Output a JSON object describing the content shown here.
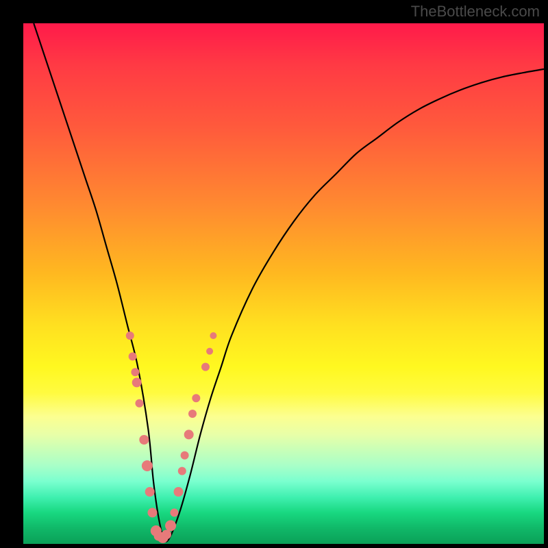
{
  "watermark": "TheBottleneck.com",
  "chart_data": {
    "type": "line",
    "title": "",
    "xlabel": "",
    "ylabel": "",
    "xlim": [
      0,
      100
    ],
    "ylim": [
      0,
      100
    ],
    "series": [
      {
        "name": "bottleneck-curve",
        "x": [
          2,
          4,
          6,
          8,
          10,
          12,
          14,
          16,
          18,
          20,
          22,
          24,
          25,
          26,
          27,
          28,
          30,
          32,
          34,
          36,
          38,
          40,
          44,
          48,
          52,
          56,
          60,
          64,
          68,
          72,
          76,
          80,
          84,
          88,
          92,
          96,
          100
        ],
        "y": [
          100,
          94,
          88,
          82,
          76,
          70,
          64,
          57,
          50,
          42,
          34,
          22,
          12,
          5,
          1,
          1,
          6,
          13,
          21,
          28,
          34,
          40,
          49,
          56,
          62,
          67,
          71,
          75,
          78,
          81,
          83.5,
          85.5,
          87.2,
          88.6,
          89.7,
          90.5,
          91.2
        ]
      }
    ],
    "scatter_points": {
      "name": "data-dots",
      "color": "#e77a7a",
      "points": [
        {
          "x": 20.5,
          "y": 40,
          "r": 6
        },
        {
          "x": 21.0,
          "y": 36,
          "r": 6
        },
        {
          "x": 21.5,
          "y": 33,
          "r": 6
        },
        {
          "x": 21.8,
          "y": 31,
          "r": 7
        },
        {
          "x": 22.3,
          "y": 27,
          "r": 6
        },
        {
          "x": 23.2,
          "y": 20,
          "r": 7
        },
        {
          "x": 23.8,
          "y": 15,
          "r": 8
        },
        {
          "x": 24.3,
          "y": 10,
          "r": 7
        },
        {
          "x": 24.8,
          "y": 6,
          "r": 7
        },
        {
          "x": 25.5,
          "y": 2.5,
          "r": 8
        },
        {
          "x": 26.0,
          "y": 1.5,
          "r": 7
        },
        {
          "x": 26.8,
          "y": 1.2,
          "r": 8
        },
        {
          "x": 27.5,
          "y": 1.8,
          "r": 7
        },
        {
          "x": 28.3,
          "y": 3.5,
          "r": 8
        },
        {
          "x": 29.0,
          "y": 6,
          "r": 6
        },
        {
          "x": 29.8,
          "y": 10,
          "r": 7
        },
        {
          "x": 30.5,
          "y": 14,
          "r": 6
        },
        {
          "x": 31.0,
          "y": 17,
          "r": 6
        },
        {
          "x": 31.8,
          "y": 21,
          "r": 7
        },
        {
          "x": 32.5,
          "y": 25,
          "r": 6
        },
        {
          "x": 33.2,
          "y": 28,
          "r": 6
        },
        {
          "x": 35.0,
          "y": 34,
          "r": 6
        },
        {
          "x": 35.8,
          "y": 37,
          "r": 5
        },
        {
          "x": 36.5,
          "y": 40,
          "r": 5
        }
      ]
    },
    "background_gradient": {
      "direction": "vertical",
      "stops": [
        {
          "pos": 0,
          "color": "#ff1a4a"
        },
        {
          "pos": 35,
          "color": "#ff8a30"
        },
        {
          "pos": 66,
          "color": "#fff820"
        },
        {
          "pos": 100,
          "color": "#0aa058"
        }
      ]
    }
  }
}
